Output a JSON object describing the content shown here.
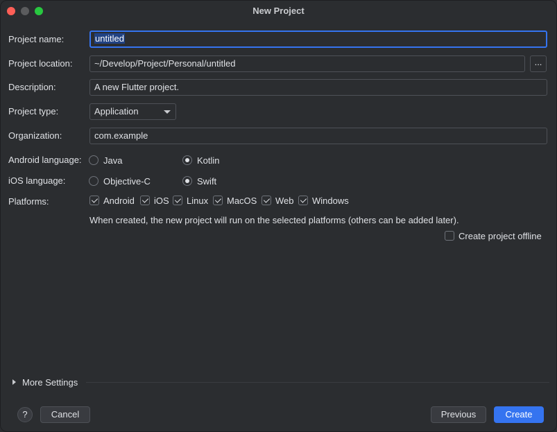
{
  "window": {
    "title": "New Project"
  },
  "form": {
    "project_name_label": "Project name:",
    "project_name_value": "untitled",
    "project_location_label": "Project location:",
    "project_location_value": "~/Develop/Project/Personal/untitled",
    "browse_label": "...",
    "description_label": "Description:",
    "description_value": "A new Flutter project.",
    "project_type_label": "Project type:",
    "project_type_value": "Application",
    "organization_label": "Organization:",
    "organization_value": "com.example",
    "android_language_label": "Android language:",
    "android_options": [
      {
        "label": "Java",
        "selected": false
      },
      {
        "label": "Kotlin",
        "selected": true
      }
    ],
    "ios_language_label": "iOS language:",
    "ios_options": [
      {
        "label": "Objective-C",
        "selected": false
      },
      {
        "label": "Swift",
        "selected": true
      }
    ],
    "platforms_label": "Platforms:",
    "platforms": [
      {
        "label": "Android",
        "checked": true
      },
      {
        "label": "iOS",
        "checked": true
      },
      {
        "label": "Linux",
        "checked": true
      },
      {
        "label": "MacOS",
        "checked": true
      },
      {
        "label": "Web",
        "checked": true
      },
      {
        "label": "Windows",
        "checked": true
      }
    ],
    "platforms_hint": "When created, the new project will run on the selected platforms (others can be added later).",
    "offline_label": "Create project offline",
    "offline_checked": false
  },
  "more_settings": {
    "label": "More Settings"
  },
  "footer": {
    "help_label": "?",
    "cancel_label": "Cancel",
    "previous_label": "Previous",
    "create_label": "Create"
  },
  "colors": {
    "background": "#2b2d30",
    "accent": "#3574f0",
    "selection": "#214283",
    "close": "#ff5f57",
    "maximize": "#28c840"
  }
}
